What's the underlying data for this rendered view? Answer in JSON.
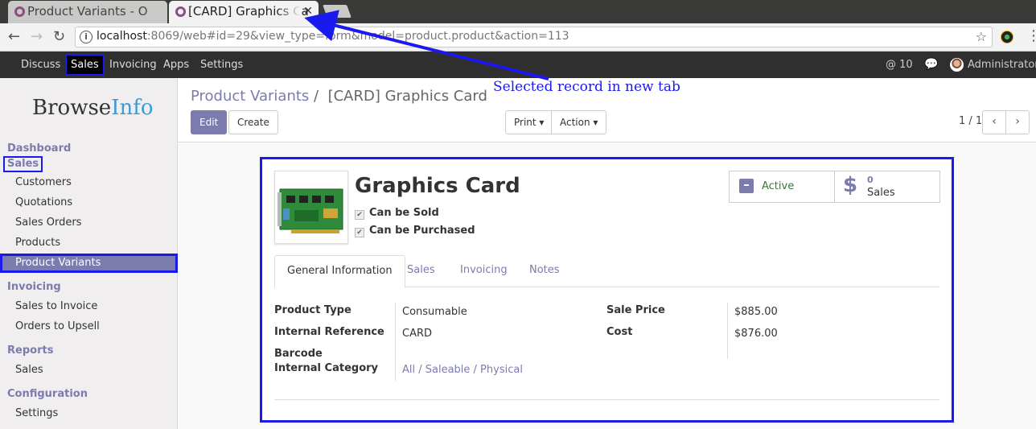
{
  "browser": {
    "tabs": [
      {
        "title": "Product Variants - O"
      },
      {
        "title": "[CARD] Graphics Ca",
        "close": "✕"
      }
    ],
    "url_host": "localhost",
    "url_rest": ":8069/web#id=29&view_type=form&model=product.product&action=113"
  },
  "topnav": {
    "menus": [
      "Discuss",
      "Sales",
      "Invoicing",
      "Apps",
      "Settings"
    ],
    "mentions": "@ 10",
    "user": "Administrator"
  },
  "sidebar": {
    "logo_browse": "Browse",
    "logo_info": "Info",
    "dashboard": "Dashboard",
    "sales_header": "Sales",
    "sales_items": [
      "Customers",
      "Quotations",
      "Sales Orders",
      "Products",
      "Product Variants"
    ],
    "invoicing_header": "Invoicing",
    "invoicing_items": [
      "Sales to Invoice",
      "Orders to Upsell"
    ],
    "reports_header": "Reports",
    "reports_items": [
      "Sales"
    ],
    "config_header": "Configuration",
    "config_items": [
      "Settings"
    ]
  },
  "control_panel": {
    "breadcrumb_parent": "Product Variants",
    "breadcrumb_sep": "/",
    "breadcrumb_current": "[CARD] Graphics Card",
    "edit_label": "Edit",
    "create_label": "Create",
    "print_label": "Print",
    "action_label": "Action",
    "pager": "1 / 1"
  },
  "form": {
    "name": "Graphics Card",
    "can_be_sold": "Can be Sold",
    "can_be_purchased": "Can be Purchased",
    "stat_active": "Active",
    "stat_sales_count": "0",
    "stat_sales_label": "Sales",
    "tabs": [
      "General Information",
      "Sales",
      "Invoicing",
      "Notes"
    ],
    "fields_left": [
      {
        "label": "Product Type",
        "value": "Consumable"
      },
      {
        "label": "Internal Reference",
        "value": "CARD"
      },
      {
        "label": "Barcode",
        "value": ""
      },
      {
        "label": "Internal Category",
        "value": "All / Saleable / Physical"
      }
    ],
    "fields_right": [
      {
        "label": "Sale Price",
        "value": "$885.00"
      },
      {
        "label": "Cost",
        "value": "$876.00"
      }
    ]
  },
  "annotation": {
    "text": "Selected record in new tab"
  },
  "colors": {
    "accent": "#7c7bad",
    "highlight_border": "#1a1aee",
    "nav_bg": "#2f2f2f"
  }
}
